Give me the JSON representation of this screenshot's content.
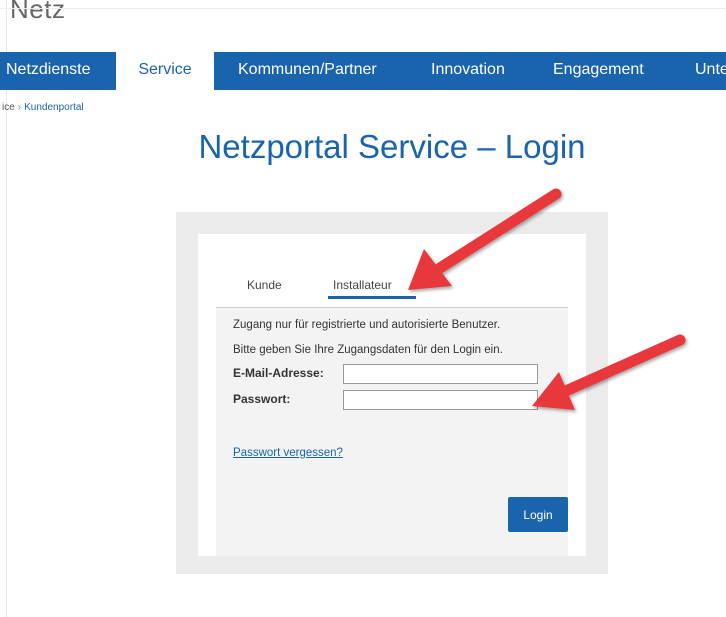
{
  "brand": "Netz",
  "nav": {
    "items": [
      "Netzdienste",
      "Service",
      "Kommunen/Partner",
      "Innovation",
      "Engagement",
      "Unte"
    ],
    "active": "Service"
  },
  "breadcrumb": {
    "parent": "ice",
    "current": "Kundenportal"
  },
  "page_title": "Netzportal Service – Login",
  "tabs": {
    "kunde": "Kunde",
    "installateur": "Installateur",
    "active": "Installateur"
  },
  "form": {
    "message1": "Zugang nur für registrierte und autorisierte Benutzer.",
    "message2": "Bitte geben Sie Ihre Zugangsdaten für den Login ein.",
    "email_label": "E-Mail-Adresse:",
    "email_value": "",
    "password_label": "Passwort:",
    "password_value": "",
    "forgot_link": "Passwort vergessen?",
    "login_button": "Login"
  },
  "colors": {
    "brand_blue": "#1a63ad",
    "annotation_arrow": "#e8393a"
  }
}
